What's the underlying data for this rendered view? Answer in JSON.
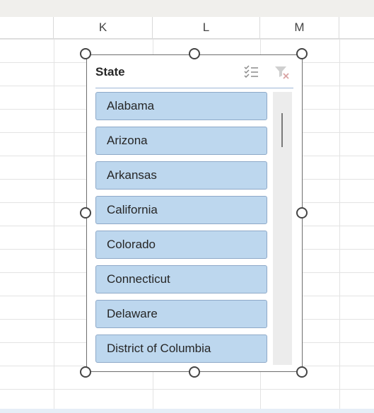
{
  "sheet": {
    "columns": [
      {
        "id": "col-k",
        "label": "K"
      },
      {
        "id": "col-l",
        "label": "L"
      },
      {
        "id": "col-m",
        "label": "M"
      }
    ]
  },
  "slicer": {
    "title": "State",
    "multiselect_icon": "multi-select-icon",
    "clear_filter_icon": "clear-filter-icon",
    "items": [
      {
        "label": "Alabama"
      },
      {
        "label": "Arizona"
      },
      {
        "label": "Arkansas"
      },
      {
        "label": "California"
      },
      {
        "label": "Colorado"
      },
      {
        "label": "Connecticut"
      },
      {
        "label": "Delaware"
      },
      {
        "label": "District of Columbia"
      }
    ],
    "colors": {
      "item_fill": "#bdd7ee",
      "item_border": "#8ea9c8",
      "frame": "#6e6e6e"
    }
  }
}
